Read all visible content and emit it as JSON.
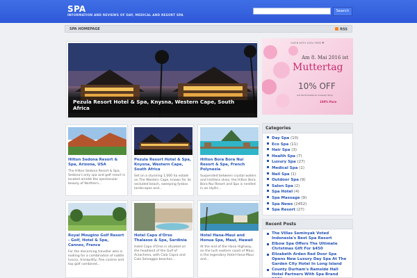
{
  "header": {
    "title": "SPA",
    "tagline": "INFORMATION AND REVIEWS OF DAY, MEDICAL AND RESORT SPA",
    "search_placeholder": "",
    "search_button": "Search"
  },
  "nav": {
    "home": "SPA HOMEPAGE",
    "rss": "RSS"
  },
  "featured": {
    "caption": "Pezula Resort Hotel & Spa, Knysna, Western Cape, South Africa"
  },
  "ad": {
    "top": "GIVEN WITH 100% PURE ♥",
    "date": "Am 8. Mai 2016 ist",
    "title": "Muttertag",
    "offer": "10% OFF",
    "small": "auf die Produkte im unserem Shop",
    "brand": "100% Pure"
  },
  "cards": [
    {
      "title": "Hilton Sedona Resort & Spa, Arizona, USA",
      "excerpt": "The Hilton Sedona Resort & Spa, Sedona's only spa and golf resort is located amidst the spectacular beauty of Northern..."
    },
    {
      "title": "Pezula Resort Hotel & Spa, Knysna, Western Cape, South Africa",
      "excerpt": "Set on a stunning 1,000 ha estate on The Western Cape, known for its secluded beach, sweeping fynbos landscapes and..."
    },
    {
      "title": "Hilton Bora Bora Nui Resort & Spa, French Polynesia",
      "excerpt": "Suspended between crystal waters and limitless skies, the Hilton Bora Bora Nui Resort and Spa is nestled in an idyllic..."
    },
    {
      "title": "Royal Mougins Golf Resort - Golf, Hotel & Spa, Cannes, France",
      "excerpt": "For the discerning traveller who is looking for a combination of subtle luxury, tranquility, fine cuisine and top golf combined..."
    },
    {
      "title": "Hotel Capo d'Orso Thalasso & Spa, Sardinia",
      "excerpt": "Hotel Capo d'Orso is situated on the headland of the Gulf of Arzachena, with Cala Capra and Cala Selvaggia beaches..."
    },
    {
      "title": "Hotel Hana-Maui and Honua Spa, Maui, Hawaii",
      "excerpt": "At the end of the Hana Highway, on the lush eastern coast of Maui, is the legendary Hotel Hana-Maui and..."
    }
  ],
  "categories": {
    "heading": "Categories",
    "items": [
      {
        "name": "Day Spa",
        "count": "(10)"
      },
      {
        "name": "Eco Spa",
        "count": "(11)"
      },
      {
        "name": "Hair Spa",
        "count": "(3)"
      },
      {
        "name": "Health Spa",
        "count": "(7)"
      },
      {
        "name": "Luxury Spa",
        "count": "(27)"
      },
      {
        "name": "Medical Spa",
        "count": "(1)"
      },
      {
        "name": "Nail Spa",
        "count": "(1)"
      },
      {
        "name": "Outdoor Spa",
        "count": "(9)"
      },
      {
        "name": "Salon Spa",
        "count": "(2)"
      },
      {
        "name": "Spa Hotel",
        "count": "(4)"
      },
      {
        "name": "Spa Massage",
        "count": "(9)"
      },
      {
        "name": "Spa News",
        "count": "(2452)"
      },
      {
        "name": "Spa Resort",
        "count": "(27)"
      }
    ]
  },
  "recent": {
    "heading": "Recent Posts",
    "items": [
      "The Villas Seminyak Voted Indonesia's Best Spa Resort",
      "Elbow Spa Offers The Ultimate Christmas Gift For $450",
      "Elizabeth Arden Red Door Spa Opens New Luxury Day Spa At The Garden City Hotel In Long Island",
      "County Durham's Ramside Hall Hotel Partners With Spa Brand ESPA"
    ]
  }
}
